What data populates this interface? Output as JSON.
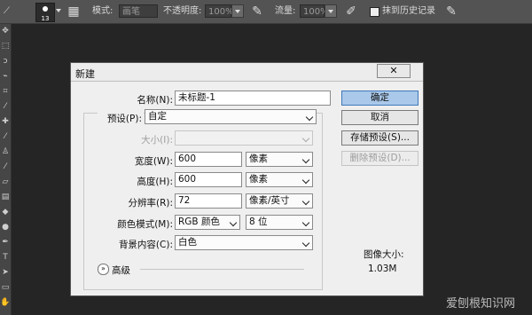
{
  "options_bar": {
    "brush_size": "13",
    "mode_label": "模式:",
    "mode_value": "画笔",
    "opacity_label": "不透明度:",
    "opacity_value": "100%",
    "flow_label": "流量:",
    "flow_value": "100%",
    "erase_history_label": "抹到历史记录"
  },
  "dialog": {
    "title": "新建",
    "close": "✕",
    "name_label": "名称(N):",
    "name_value": "未标题-1",
    "preset_label": "预设(P):",
    "preset_value": "自定",
    "size_label": "大小(I):",
    "width_label": "宽度(W):",
    "width_value": "600",
    "width_unit": "像素",
    "height_label": "高度(H):",
    "height_value": "600",
    "height_unit": "像素",
    "resolution_label": "分辨率(R):",
    "resolution_value": "72",
    "resolution_unit": "像素/英寸",
    "color_mode_label": "颜色模式(M):",
    "color_mode_value": "RGB 颜色",
    "bit_depth_value": "8 位",
    "background_label": "背景内容(C):",
    "background_value": "白色",
    "advanced_label": "高级",
    "ok_label": "确定",
    "cancel_label": "取消",
    "save_preset_label": "存储预设(S)...",
    "delete_preset_label": "删除预设(D)...",
    "image_size_label": "图像大小:",
    "image_size_value": "1.03M"
  },
  "watermark": "爱刨根知识网"
}
